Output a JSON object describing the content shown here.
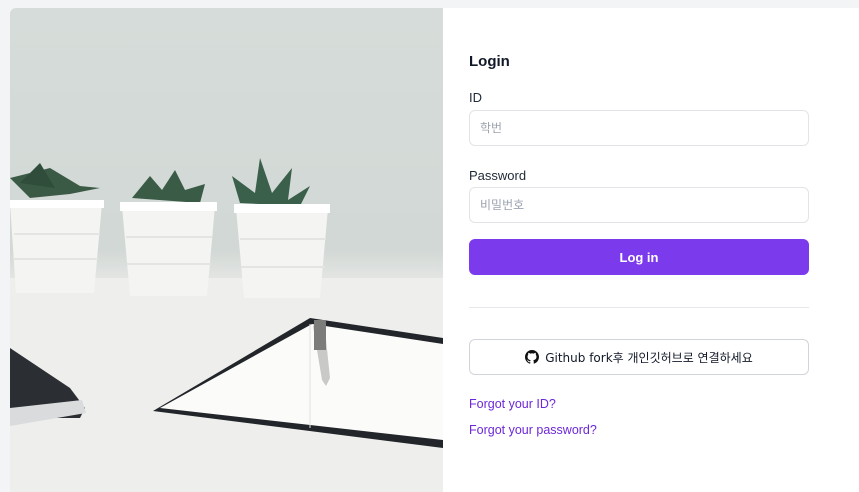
{
  "login": {
    "title": "Login",
    "id_label": "ID",
    "id_placeholder": "학번",
    "password_label": "Password",
    "password_placeholder": "비밀번호",
    "submit_label": "Log in",
    "github_label": "Github fork후 개인깃허브로 연결하세요",
    "forgot_id": "Forgot your ID?",
    "forgot_password": "Forgot your password?"
  },
  "icons": {
    "github": "github-icon"
  },
  "colors": {
    "accent": "#7c3aed",
    "link": "#6d28d9",
    "background": "#f3f4f6"
  }
}
